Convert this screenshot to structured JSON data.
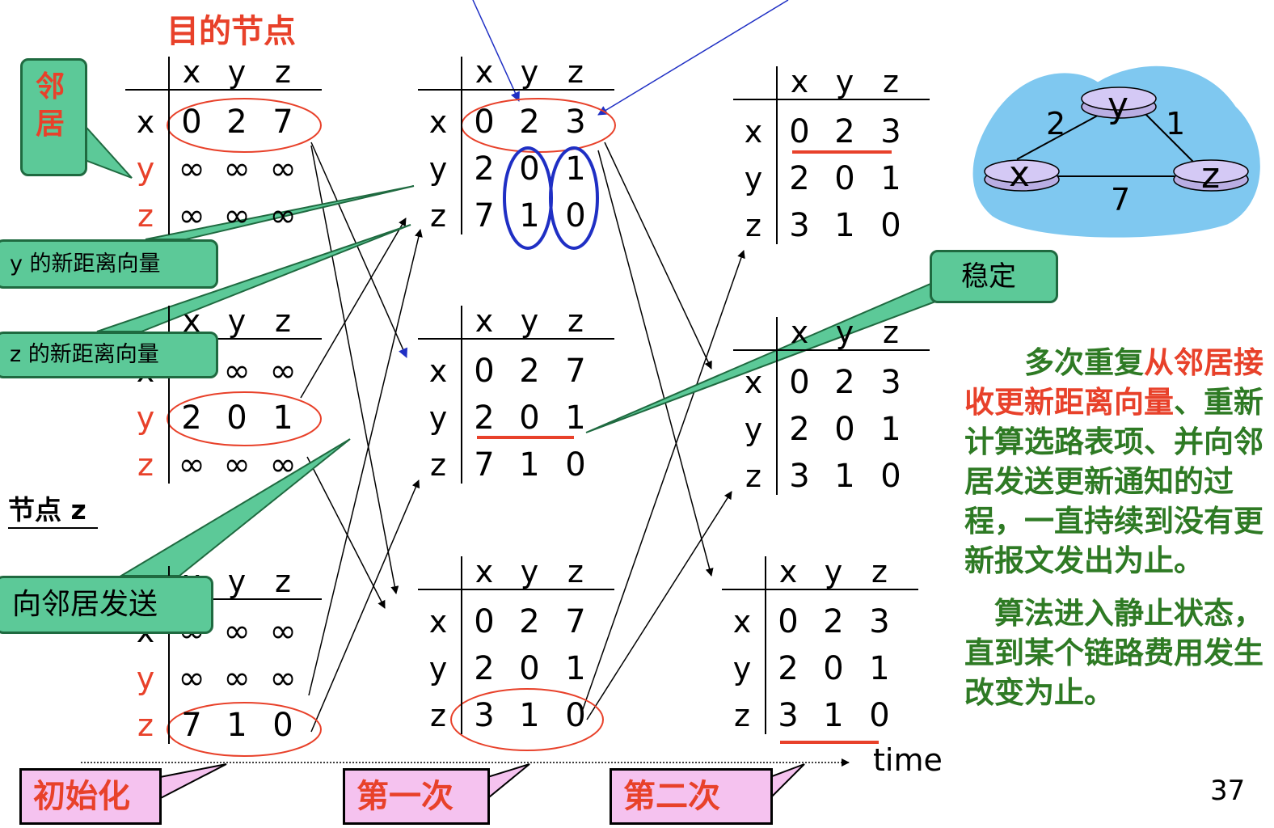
{
  "title": "目的节点",
  "callouts": {
    "neighbor": "邻\n居",
    "y_new": "y 的新距离向量",
    "z_new": "z 的新距离向量",
    "send": "向邻居发送",
    "stable": "稳定"
  },
  "node_z_label": "节点 z",
  "columns": [
    "x",
    "y",
    "z"
  ],
  "rows": [
    "x",
    "y",
    "z"
  ],
  "tables": {
    "t0x": [
      [
        "0",
        "2",
        "7"
      ],
      [
        "∞",
        "∞",
        "∞"
      ],
      [
        "∞",
        "∞",
        "∞"
      ]
    ],
    "t0y": [
      [
        "∞",
        "∞",
        "∞"
      ],
      [
        "2",
        "0",
        "1"
      ],
      [
        "∞",
        "∞",
        "∞"
      ]
    ],
    "t0z": [
      [
        "∞",
        "∞",
        "∞"
      ],
      [
        "∞",
        "∞",
        "∞"
      ],
      [
        "7",
        "1",
        "0"
      ]
    ],
    "t1x": [
      [
        "0",
        "2",
        "3"
      ],
      [
        "2",
        "0",
        "1"
      ],
      [
        "7",
        "1",
        "0"
      ]
    ],
    "t1y": [
      [
        "0",
        "2",
        "7"
      ],
      [
        "2",
        "0",
        "1"
      ],
      [
        "7",
        "1",
        "0"
      ]
    ],
    "t1z": [
      [
        "0",
        "2",
        "7"
      ],
      [
        "2",
        "0",
        "1"
      ],
      [
        "3",
        "1",
        "0"
      ]
    ],
    "t2x": [
      [
        "0",
        "2",
        "3"
      ],
      [
        "2",
        "0",
        "1"
      ],
      [
        "3",
        "1",
        "0"
      ]
    ],
    "t2y": [
      [
        "0",
        "2",
        "3"
      ],
      [
        "2",
        "0",
        "1"
      ],
      [
        "3",
        "1",
        "0"
      ]
    ],
    "t2z": [
      [
        "0",
        "2",
        "3"
      ],
      [
        "2",
        "0",
        "1"
      ],
      [
        "3",
        "1",
        "0"
      ]
    ]
  },
  "graph": {
    "nodes": [
      "x",
      "y",
      "z"
    ],
    "edges": [
      {
        "from": "x",
        "to": "y",
        "cost": "2"
      },
      {
        "from": "y",
        "to": "z",
        "cost": "1"
      },
      {
        "from": "x",
        "to": "z",
        "cost": "7"
      }
    ]
  },
  "side_text": {
    "p1_a": "多次重复",
    "p1_b": "从邻居接收更新距离向量",
    "p1_c": "、重新计算选路表项、并向邻居发送更新通知的过程，一直持续到没有更新报文发出为止。",
    "p2": "算法进入静止状态，直到某个链路费用发生改变为止。"
  },
  "timeline": {
    "label": "time",
    "stages": [
      "初始化",
      "第一次",
      "第二次"
    ]
  },
  "page_number": "37",
  "colors": {
    "callout_green": "#5cc998",
    "callout_border": "#1f6a40",
    "red": "#e8412a",
    "blue": "#1f2fc4",
    "pink": "#f5c2ef",
    "cloud": "#7fc8f0",
    "side_text_green": "#2e7a24"
  }
}
